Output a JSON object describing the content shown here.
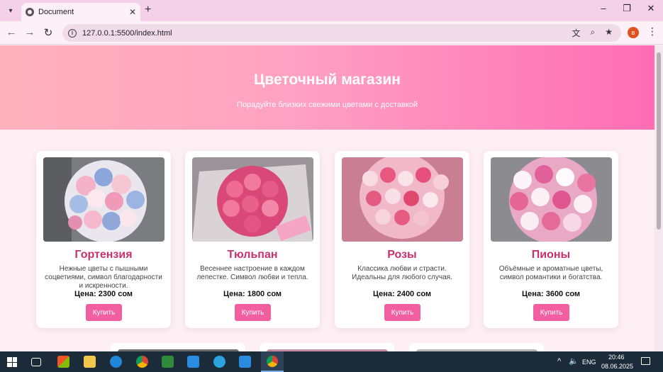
{
  "browser": {
    "tab_title": "Document",
    "url": "127.0.0.1:5500/index.html",
    "profile_initial": "в"
  },
  "hero": {
    "title": "Цветочный магазин",
    "subtitle": "Порадуйте близких свежими цветами с доставкой"
  },
  "products": [
    {
      "name": "Гортензия",
      "description": "Нежные цветы с пышными соцветиями, символ благодарности и искренности.",
      "price": "Цена: 2300 сом",
      "button": "Купить"
    },
    {
      "name": "Тюльпан",
      "description": "Весеннее настроение в каждом лепестке. Символ любви и тепла.",
      "price": "Цена: 1800 сом",
      "button": "Купить"
    },
    {
      "name": "Розы",
      "description": "Классика любви и страсти. Идеальны для любого случая.",
      "price": "Цена: 2400 сом",
      "button": "Купить"
    },
    {
      "name": "Пионы",
      "description": "Объёмные и ароматные цветы, символ романтики и богатства.",
      "price": "Цена: 3600 сом",
      "button": "Купить"
    }
  ],
  "taskbar": {
    "language": "ENG",
    "time": "20:46",
    "date": "08.06.2025"
  },
  "colors": {
    "accent": "#f15fa0",
    "title_pink": "#c8306e"
  }
}
